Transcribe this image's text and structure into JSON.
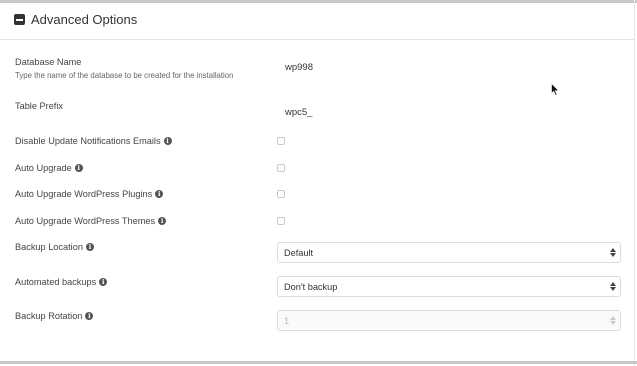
{
  "section": {
    "title": "Advanced Options"
  },
  "fields": {
    "database_name": {
      "label": "Database Name",
      "description": "Type the name of the database to be created for the installation",
      "value": "wp998"
    },
    "table_prefix": {
      "label": "Table Prefix",
      "value": "wpc5_"
    },
    "disable_update_emails": {
      "label": "Disable Update Notifications Emails",
      "checked": false
    },
    "auto_upgrade": {
      "label": "Auto Upgrade",
      "checked": false
    },
    "auto_upgrade_plugins": {
      "label": "Auto Upgrade WordPress Plugins",
      "checked": false
    },
    "auto_upgrade_themes": {
      "label": "Auto Upgrade WordPress Themes",
      "checked": false
    },
    "backup_location": {
      "label": "Backup Location",
      "selected": "Default"
    },
    "automated_backups": {
      "label": "Automated backups",
      "selected": "Don't backup"
    },
    "backup_rotation": {
      "label": "Backup Rotation",
      "selected": "1",
      "disabled": true
    }
  },
  "icons": {
    "collapse": "minus-square-icon",
    "info": "info-circle-icon",
    "cursor": "mouse-pointer-icon"
  }
}
